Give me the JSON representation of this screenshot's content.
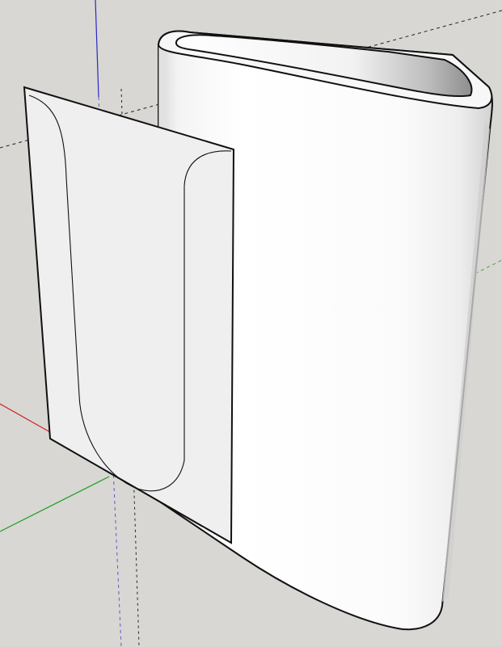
{
  "viewport": {
    "background_color": "#d8d7d3"
  },
  "axes": {
    "red_axis_color": "#d02020",
    "green_axis_color": "#1a9e1a",
    "blue_axis_color": "#2828c8",
    "inference_line_color": "#222222"
  },
  "model": {
    "solid_body_color": "#ffffff",
    "shadow_color": "#cfcfcf",
    "inner_rim_color": "#bfbfbf",
    "section_plane_color": "#eeeeee",
    "edge_color": "#111111"
  }
}
